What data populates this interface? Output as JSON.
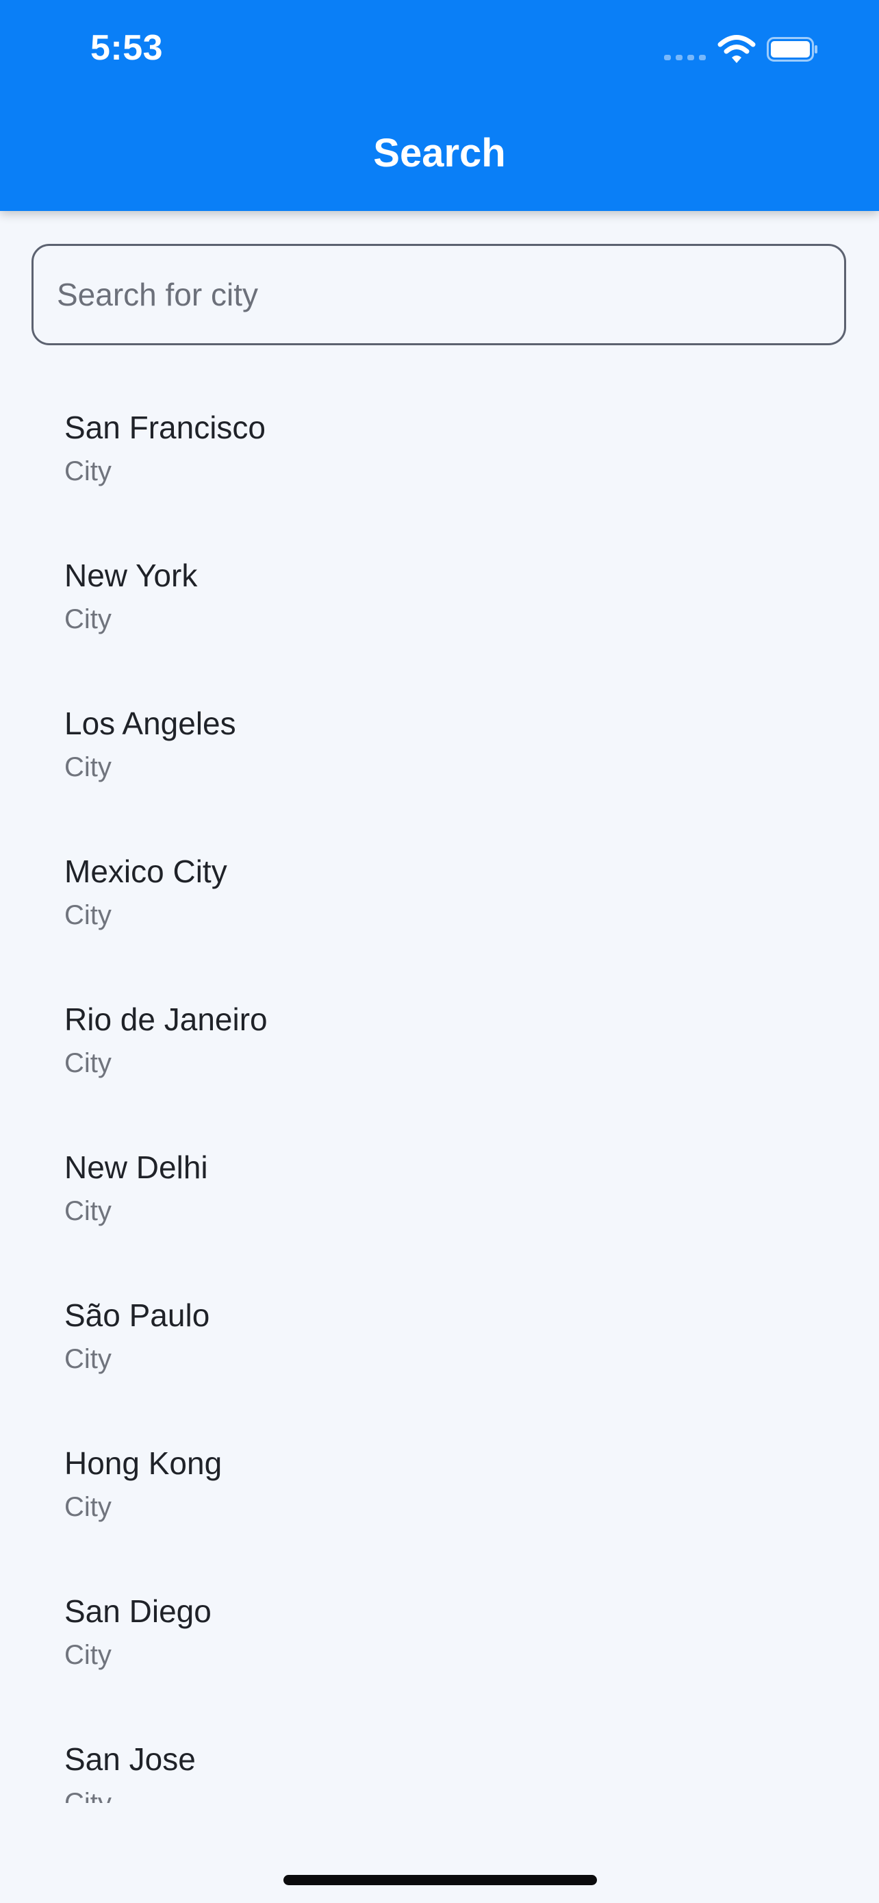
{
  "status_bar": {
    "time": "5:53"
  },
  "header": {
    "title": "Search",
    "background_color": "#0a7ff7"
  },
  "search": {
    "placeholder": "Search for city",
    "value": ""
  },
  "results": [
    {
      "name": "San Francisco",
      "type": "City"
    },
    {
      "name": "New York",
      "type": "City"
    },
    {
      "name": "Los Angeles",
      "type": "City"
    },
    {
      "name": "Mexico City",
      "type": "City"
    },
    {
      "name": "Rio de Janeiro",
      "type": "City"
    },
    {
      "name": "New Delhi",
      "type": "City"
    },
    {
      "name": "São Paulo",
      "type": "City"
    },
    {
      "name": "Hong Kong",
      "type": "City"
    },
    {
      "name": "San Diego",
      "type": "City"
    },
    {
      "name": "San Jose",
      "type": "City"
    }
  ]
}
